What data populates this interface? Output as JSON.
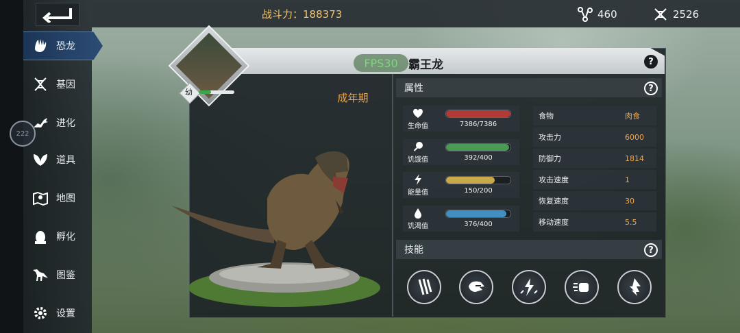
{
  "header": {
    "power_label": "战斗力：",
    "power_value": "188373",
    "dna_value": "460",
    "gene_value": "2526"
  },
  "sidebar": {
    "items": [
      {
        "label": "恐龙",
        "icon": "dino-claw-icon"
      },
      {
        "label": "基因",
        "icon": "dna-icon"
      },
      {
        "label": "进化",
        "icon": "evolution-icon"
      },
      {
        "label": "道具",
        "icon": "leaf-icon"
      },
      {
        "label": "地图",
        "icon": "map-pin-icon"
      },
      {
        "label": "孵化",
        "icon": "egg-icon"
      },
      {
        "label": "图鉴",
        "icon": "dino-silhouette-icon"
      },
      {
        "label": "设置",
        "icon": "gear-icon"
      }
    ],
    "active": "恐龙"
  },
  "fps_ring_text": "222",
  "dino": {
    "name": "霸王龙",
    "fps_badge": "FPS30",
    "age_label": "幼",
    "growth_fraction": 0.35,
    "stage": "成年期"
  },
  "attributes": {
    "title": "属性",
    "bars": [
      {
        "label": "生命值",
        "value": "7386/7386",
        "fraction": 1.0,
        "color": "#b33a35"
      },
      {
        "label": "饥饿值",
        "value": "392/400",
        "fraction": 0.98,
        "color": "#4a9a55"
      },
      {
        "label": "能量值",
        "value": "150/200",
        "fraction": 0.75,
        "color": "#c9a84a"
      },
      {
        "label": "饥渴值",
        "value": "376/400",
        "fraction": 0.94,
        "color": "#3f8fc0"
      }
    ],
    "table": [
      {
        "key": "食物",
        "value": "肉食"
      },
      {
        "key": "攻击力",
        "value": "6000"
      },
      {
        "key": "防御力",
        "value": "1814"
      },
      {
        "key": "攻击速度",
        "value": "1"
      },
      {
        "key": "恢复速度",
        "value": "30"
      },
      {
        "key": "移动速度",
        "value": "5.5"
      }
    ]
  },
  "skills": {
    "title": "技能",
    "icons": [
      "claw-slash-icon",
      "dino-roar-icon",
      "lightning-strike-icon",
      "charge-fist-icon",
      "rising-arrow-icon"
    ]
  },
  "colors": {
    "accent": "#f0a64a",
    "power": "#f2c36b",
    "nav_active": "#2c4c75"
  }
}
